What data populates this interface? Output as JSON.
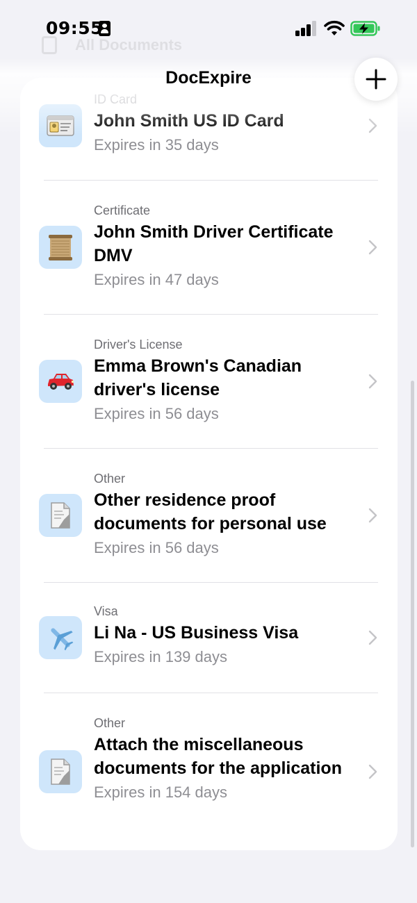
{
  "status_bar": {
    "time": "09:55"
  },
  "ghost_title": "All Documents",
  "nav": {
    "title": "DocExpire",
    "add_label": "+"
  },
  "documents": [
    {
      "category": "ID Card",
      "title": "John Smith US ID Card",
      "expiry": "Expires in 35 days",
      "icon": "id-card-icon"
    },
    {
      "category": "Certificate",
      "title": "John Smith Driver Certificate DMV",
      "expiry": "Expires in 47 days",
      "icon": "scroll-icon"
    },
    {
      "category": "Driver's License",
      "title": "Emma Brown's Canadian driver's license",
      "expiry": "Expires in 56 days",
      "icon": "car-icon"
    },
    {
      "category": "Other",
      "title": "Other residence proof documents for personal use",
      "expiry": "Expires in 56 days",
      "icon": "document-icon"
    },
    {
      "category": "Visa",
      "title": "Li Na - US Business Visa",
      "expiry": "Expires in 139 days",
      "icon": "airplane-icon"
    },
    {
      "category": "Other",
      "title": "Attach the miscellaneous documents for the application",
      "expiry": "Expires in 154 days",
      "icon": "document-icon"
    }
  ],
  "colors": {
    "icon_bg": "#cfe6fb",
    "battery": "#34c759",
    "background": "#f2f2f7"
  }
}
